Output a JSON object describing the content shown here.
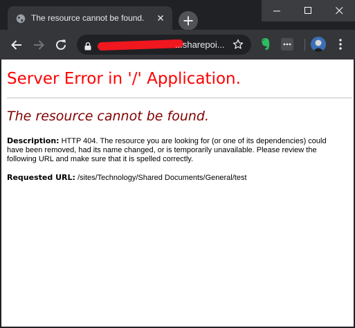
{
  "tab": {
    "title": "The resource cannot be found."
  },
  "toolbar": {
    "url_suffix": "...sharepoi..."
  },
  "page": {
    "heading": "Server Error in '/' Application.",
    "subheading": "The resource cannot be found.",
    "description_label": "Description:",
    "description_text": "HTTP 404. The resource you are looking for (or one of its dependencies) could have been removed, had its name changed, or is temporarily unavailable.  Please review the following URL and make sure that it is spelled correctly.",
    "requested_url_label": "Requested URL:",
    "requested_url": "/sites/Technology/Shared Documents/General/test"
  },
  "colors": {
    "heading": "#ff0000",
    "subheading": "#800000",
    "chrome_dark": "#202124",
    "chrome_toolbar": "#35363a",
    "redaction": "#f0171f"
  },
  "icons": [
    "globe-icon",
    "close-icon",
    "plus-icon",
    "minimize-icon",
    "maximize-icon",
    "window-close-icon",
    "back-arrow-icon",
    "forward-arrow-icon",
    "reload-icon",
    "lock-icon",
    "star-icon",
    "evernote-icon",
    "extension-icon",
    "menu-icon"
  ]
}
